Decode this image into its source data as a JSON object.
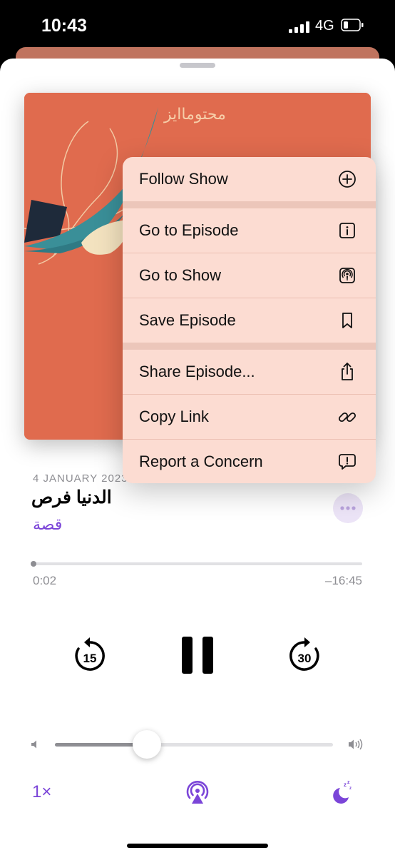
{
  "status_bar": {
    "time": "10:43",
    "network": "4G"
  },
  "artwork": {
    "logo_text": "محتوماايز"
  },
  "episode": {
    "date": "4 JANUARY 2023",
    "title": "الدنيا فرص",
    "show": "قصة"
  },
  "progress": {
    "elapsed": "0:02",
    "remaining": "–16:45",
    "fraction": 0.002
  },
  "controls": {
    "skip_back_seconds": "15",
    "skip_forward_seconds": "30",
    "volume_fraction": 0.33
  },
  "bottom": {
    "speed": "1×"
  },
  "menu": {
    "items": [
      {
        "label": "Follow Show",
        "icon": "plus-circle-icon"
      },
      {
        "label": "Go to Episode",
        "icon": "info-square-icon"
      },
      {
        "label": "Go to Show",
        "icon": "podcast-square-icon"
      },
      {
        "label": "Save Episode",
        "icon": "bookmark-icon"
      },
      {
        "label": "Share Episode...",
        "icon": "share-icon"
      },
      {
        "label": "Copy Link",
        "icon": "link-icon"
      },
      {
        "label": "Report a Concern",
        "icon": "exclamation-bubble-icon"
      }
    ]
  },
  "colors": {
    "accent": "#7b45d8",
    "artwork_bg": "#e06b4e",
    "menu_bg": "#fcdcd2"
  }
}
